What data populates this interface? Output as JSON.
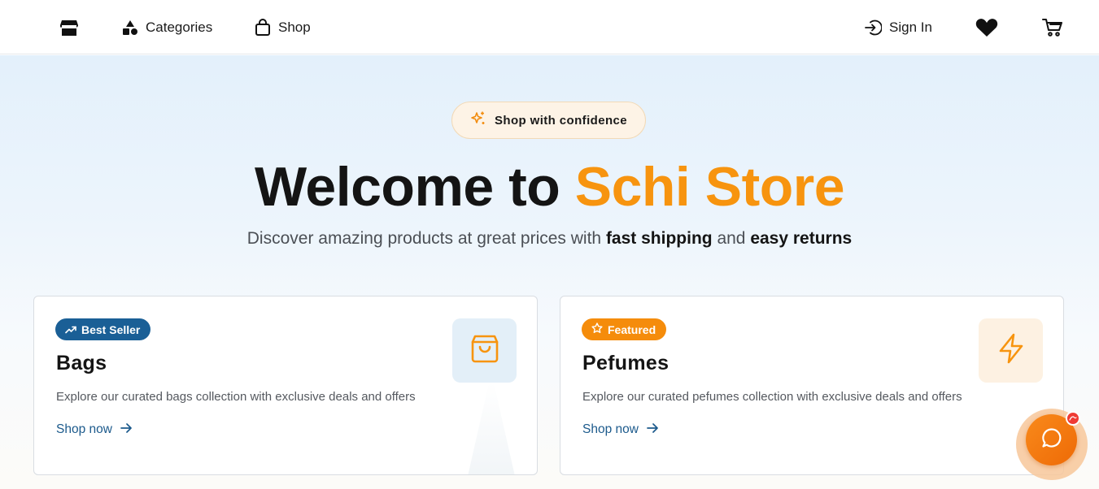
{
  "nav": {
    "categories_label": "Categories",
    "shop_label": "Shop",
    "signin_label": "Sign In"
  },
  "hero": {
    "pill_text": "Shop with confidence",
    "title_prefix": "Welcome to ",
    "title_accent": "Schi Store",
    "subtitle_prefix": "Discover amazing products at great prices with ",
    "subtitle_bold1": "fast shipping",
    "subtitle_mid": " and ",
    "subtitle_bold2": "easy returns"
  },
  "cards": [
    {
      "badge": "Best Seller",
      "title": "Bags",
      "description": "Explore our curated bags collection with exclusive deals and offers",
      "link": "Shop now",
      "icon": "shopping-bag-icon"
    },
    {
      "badge": "Featured",
      "title": "Pefumes",
      "description": "Explore our curated pefumes collection with exclusive deals and offers",
      "link": "Shop now",
      "icon": "lightning-icon"
    }
  ],
  "colors": {
    "accent": "#f7940f",
    "primary_blue": "#1a5f96",
    "badge_orange": "#f58c0b",
    "chat_orange": "#f27a10"
  }
}
